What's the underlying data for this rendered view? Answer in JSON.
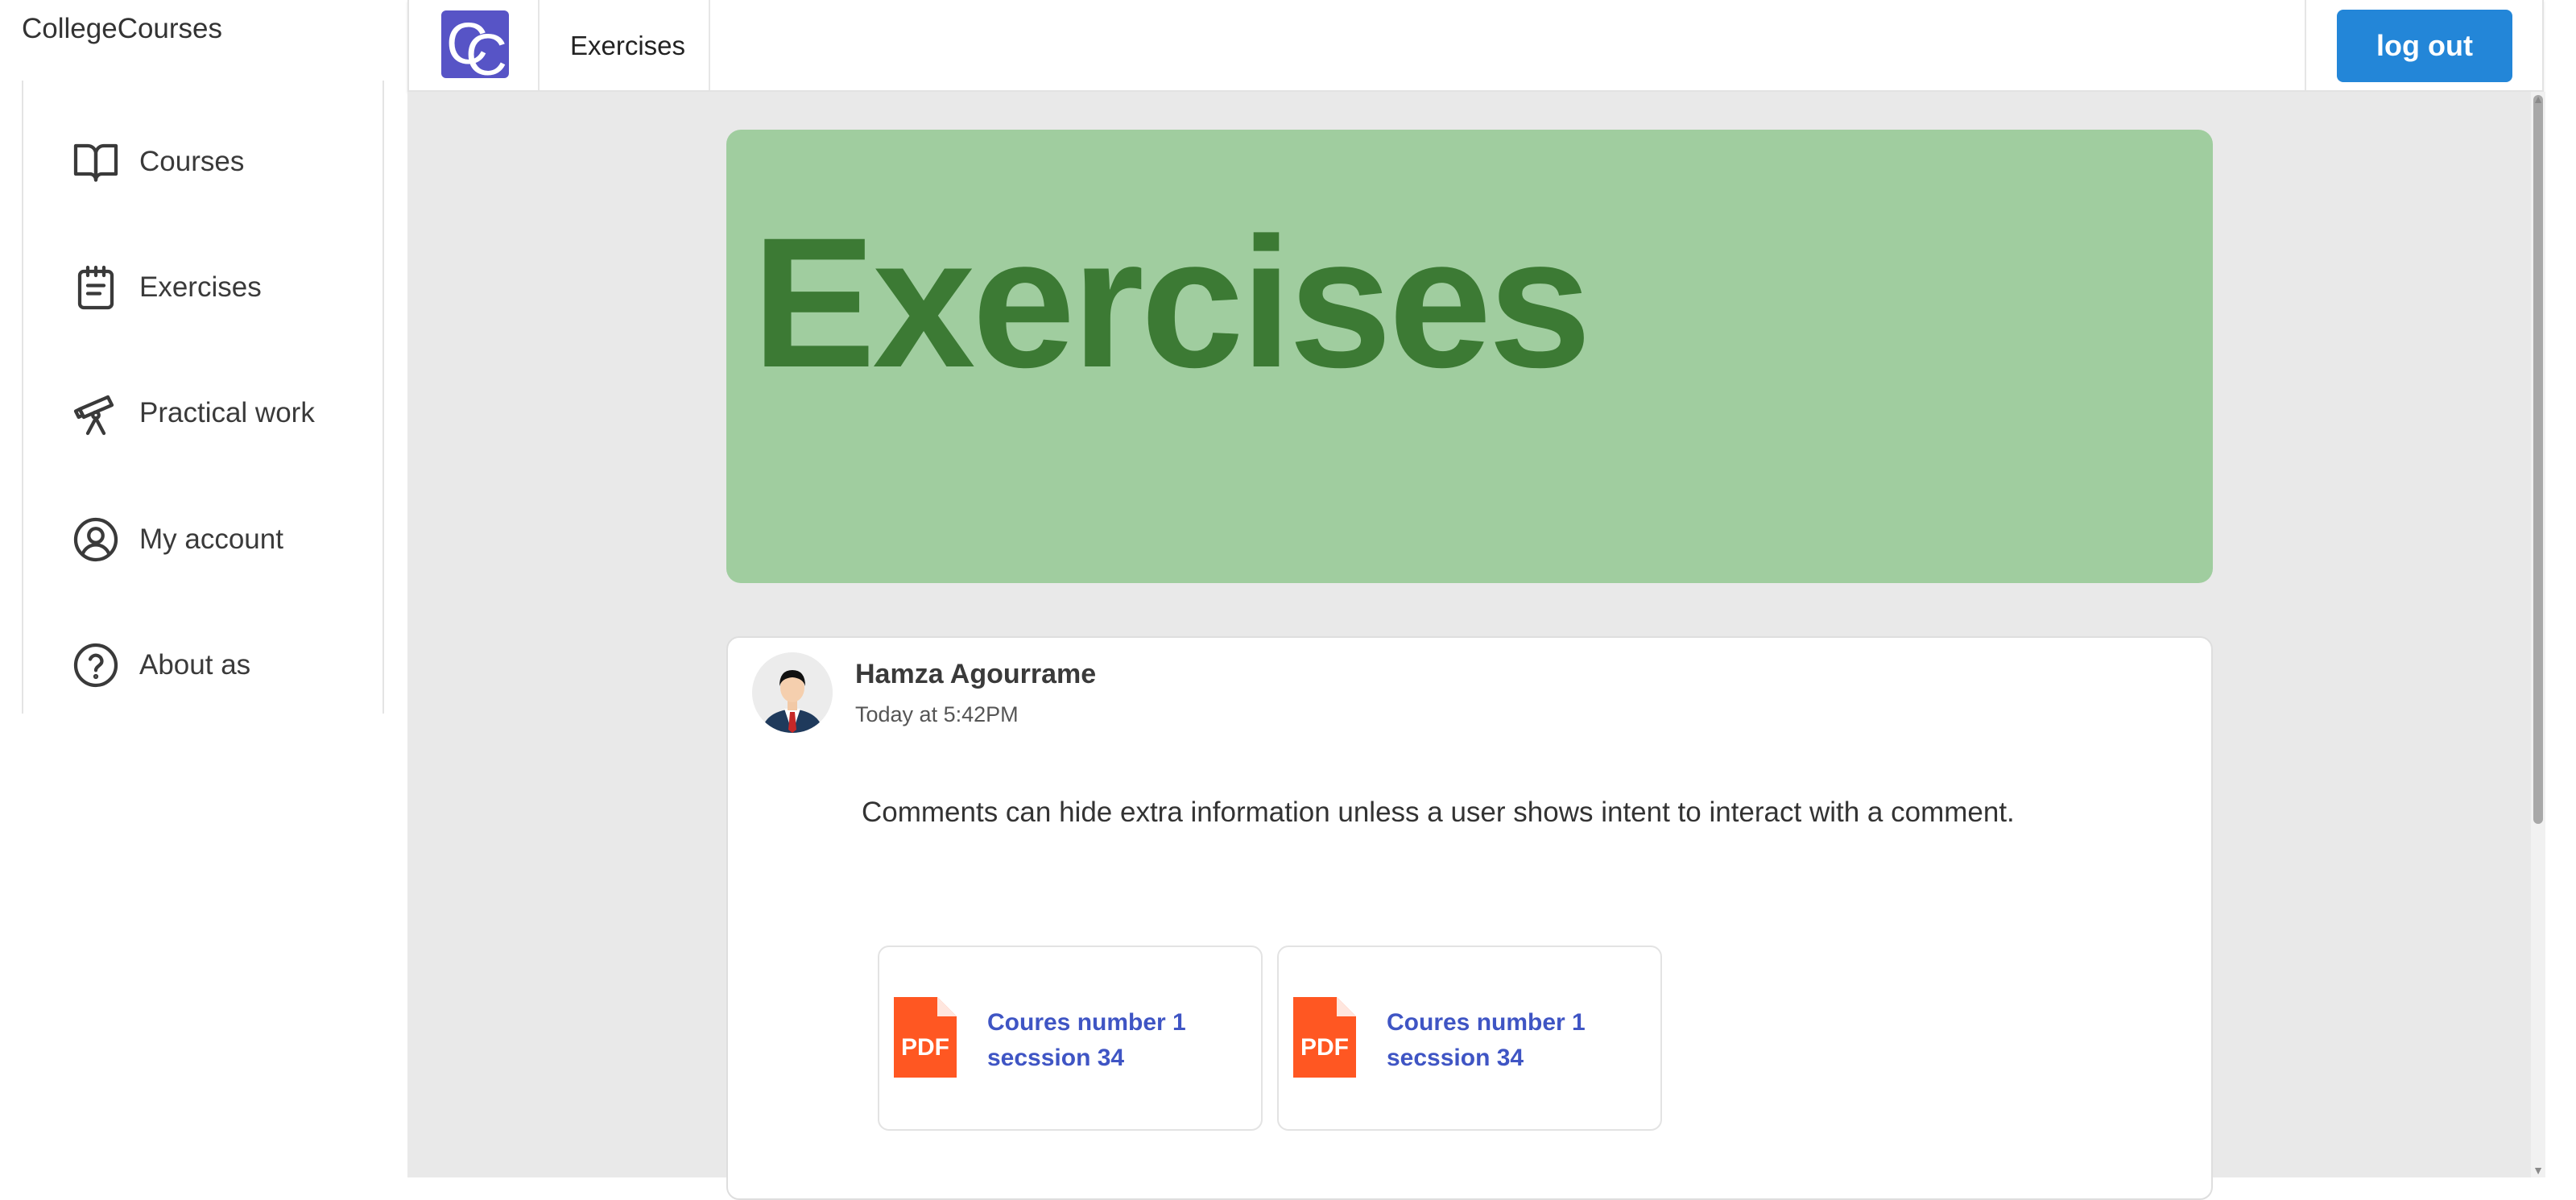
{
  "app": {
    "brand": "CollegeCourses",
    "logo_text": "CC"
  },
  "sidebar": {
    "items": [
      {
        "label": "Courses",
        "icon": "book-open-icon"
      },
      {
        "label": "Exercises",
        "icon": "notepad-icon"
      },
      {
        "label": "Practical work",
        "icon": "telescope-icon"
      },
      {
        "label": "My account",
        "icon": "user-circle-icon"
      },
      {
        "label": "About as",
        "icon": "help-circle-icon"
      }
    ]
  },
  "topbar": {
    "title": "Exercises",
    "logout_label": "log out"
  },
  "banner": {
    "title": "Exercises",
    "color": "#a0cd9f",
    "text_color": "#3c7a34"
  },
  "post": {
    "author": "Hamza Agourrame",
    "time": "Today at 5:42PM",
    "comment": "Comments can hide extra information unless a user shows intent to interact with a comment.",
    "attachments": [
      {
        "title": "Coures number 1 secssion 34",
        "type": "PDF"
      },
      {
        "title": "Coures number 1 secssion 34",
        "type": "PDF"
      }
    ]
  },
  "colors": {
    "accent": "#2386d8",
    "logo_bg": "#5754c6",
    "pdf": "#ff5722",
    "link": "#3f55c4"
  }
}
